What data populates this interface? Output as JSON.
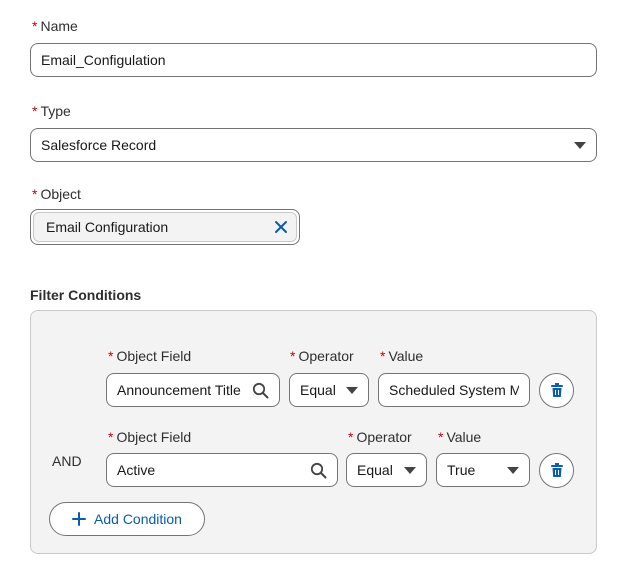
{
  "form": {
    "name": {
      "label": "Name",
      "value": "Email_Configulation"
    },
    "type": {
      "label": "Type",
      "value": "Salesforce Record"
    },
    "object": {
      "label": "Object",
      "value": "Email Configuration"
    }
  },
  "filter": {
    "title": "Filter Conditions",
    "conditions": [
      {
        "field_label": "Object Field",
        "field_value": "Announcement Title",
        "operator_label": "Operator",
        "operator_value": "Equal",
        "value_label": "Value",
        "value_value": "Scheduled System M"
      },
      {
        "connector": "AND",
        "field_label": "Object Field",
        "field_value": "Active",
        "operator_label": "Operator",
        "operator_value": "Equal",
        "value_label": "Value",
        "value_value": "True"
      }
    ],
    "add_label": "Add Condition"
  },
  "required_marker": "*",
  "colors": {
    "accent": "#0b5cab",
    "required": "#ba0517",
    "border": "#747474",
    "panel_bg": "#f3f3f3"
  },
  "icons": [
    "search-icon",
    "clear-icon",
    "chevron-down-icon",
    "delete-icon",
    "plus-icon"
  ]
}
